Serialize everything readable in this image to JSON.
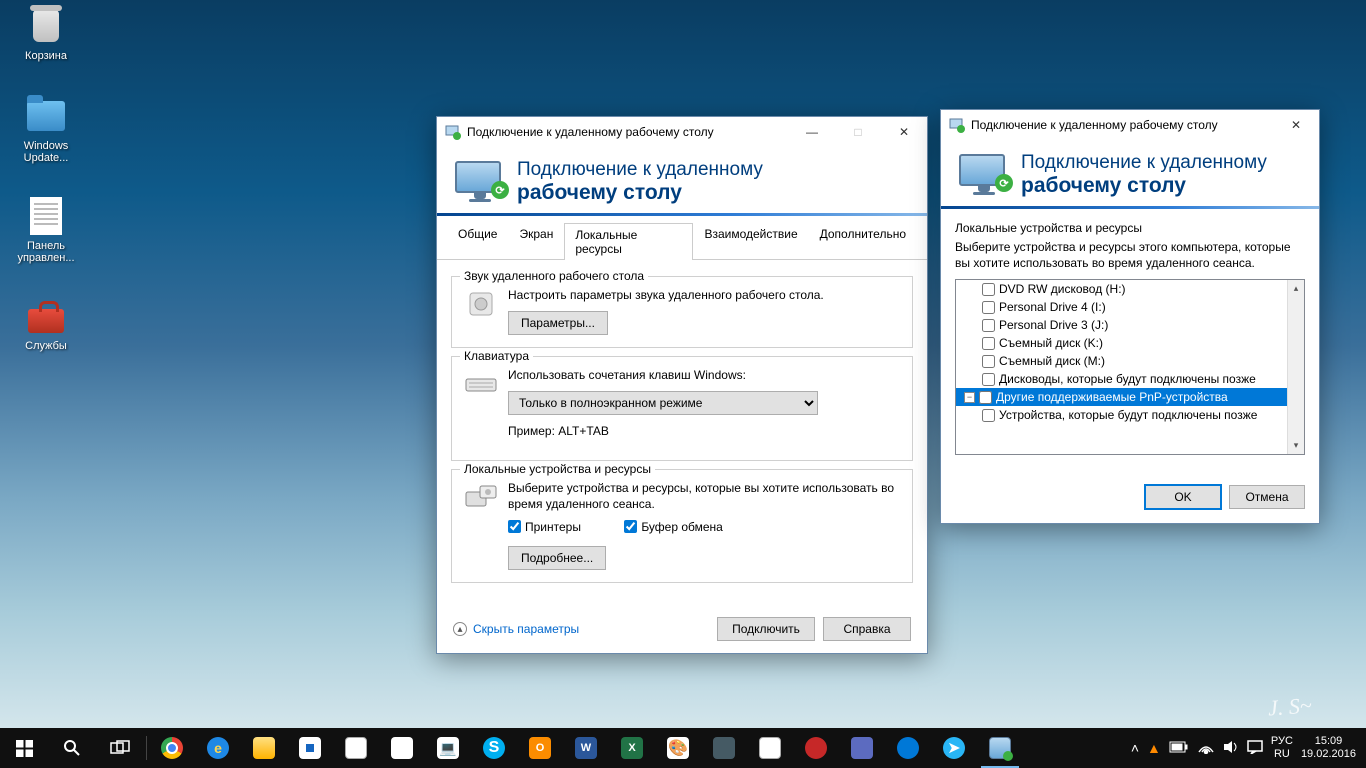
{
  "desktop_icons": {
    "recycle": "Корзина",
    "winupd": "Windows\nUpdate...",
    "ctrlpanel": "Панель\nуправлен...",
    "services": "Службы"
  },
  "win1": {
    "title": "Подключение к удаленному рабочему столу",
    "header1": "Подключение к удаленному",
    "header2": "рабочему столу",
    "tabs": {
      "general": "Общие",
      "display": "Экран",
      "local": "Локальные ресурсы",
      "experience": "Взаимодействие",
      "advanced": "Дополнительно"
    },
    "groups": {
      "sound": {
        "title": "Звук удаленного рабочего стола",
        "desc": "Настроить параметры звука удаленного рабочего стола.",
        "btn": "Параметры..."
      },
      "keyboard": {
        "title": "Клавиатура",
        "desc": "Использовать сочетания клавиш Windows:",
        "option": "Только в полноэкранном режиме",
        "example": "Пример: ALT+TAB"
      },
      "local": {
        "title": "Локальные устройства и ресурсы",
        "desc": "Выберите устройства и ресурсы, которые вы хотите использовать во время удаленного сеанса.",
        "printers": "Принтеры",
        "clipboard": "Буфер обмена",
        "more": "Подробнее..."
      }
    },
    "footer": {
      "hide": "Скрыть параметры",
      "connect": "Подключить",
      "help": "Справка"
    }
  },
  "win2": {
    "title": "Подключение к удаленному рабочему столу",
    "header1": "Подключение к удаленному",
    "header2": "рабочему столу",
    "groupTitle": "Локальные устройства и ресурсы",
    "desc": "Выберите устройства и ресурсы этого компьютера, которые вы хотите использовать во время удаленного сеанса.",
    "items": {
      "dvd": "DVD RW дисковод (H:)",
      "pd4": "Personal Drive 4 (I:)",
      "pd3": "Personal Drive 3 (J:)",
      "remk": "Съемный диск (K:)",
      "remm": "Съемный диск (M:)",
      "later": "Дисководы, которые будут подключены позже",
      "pnp": "Другие поддерживаемые PnP-устройства",
      "pnplater": "Устройства, которые будут подключены позже"
    },
    "ok": "OK",
    "cancel": "Отмена"
  },
  "taskbar": {
    "lang1": "РУС",
    "lang2": "RU",
    "time": "15:09",
    "date": "19.02.2016"
  }
}
